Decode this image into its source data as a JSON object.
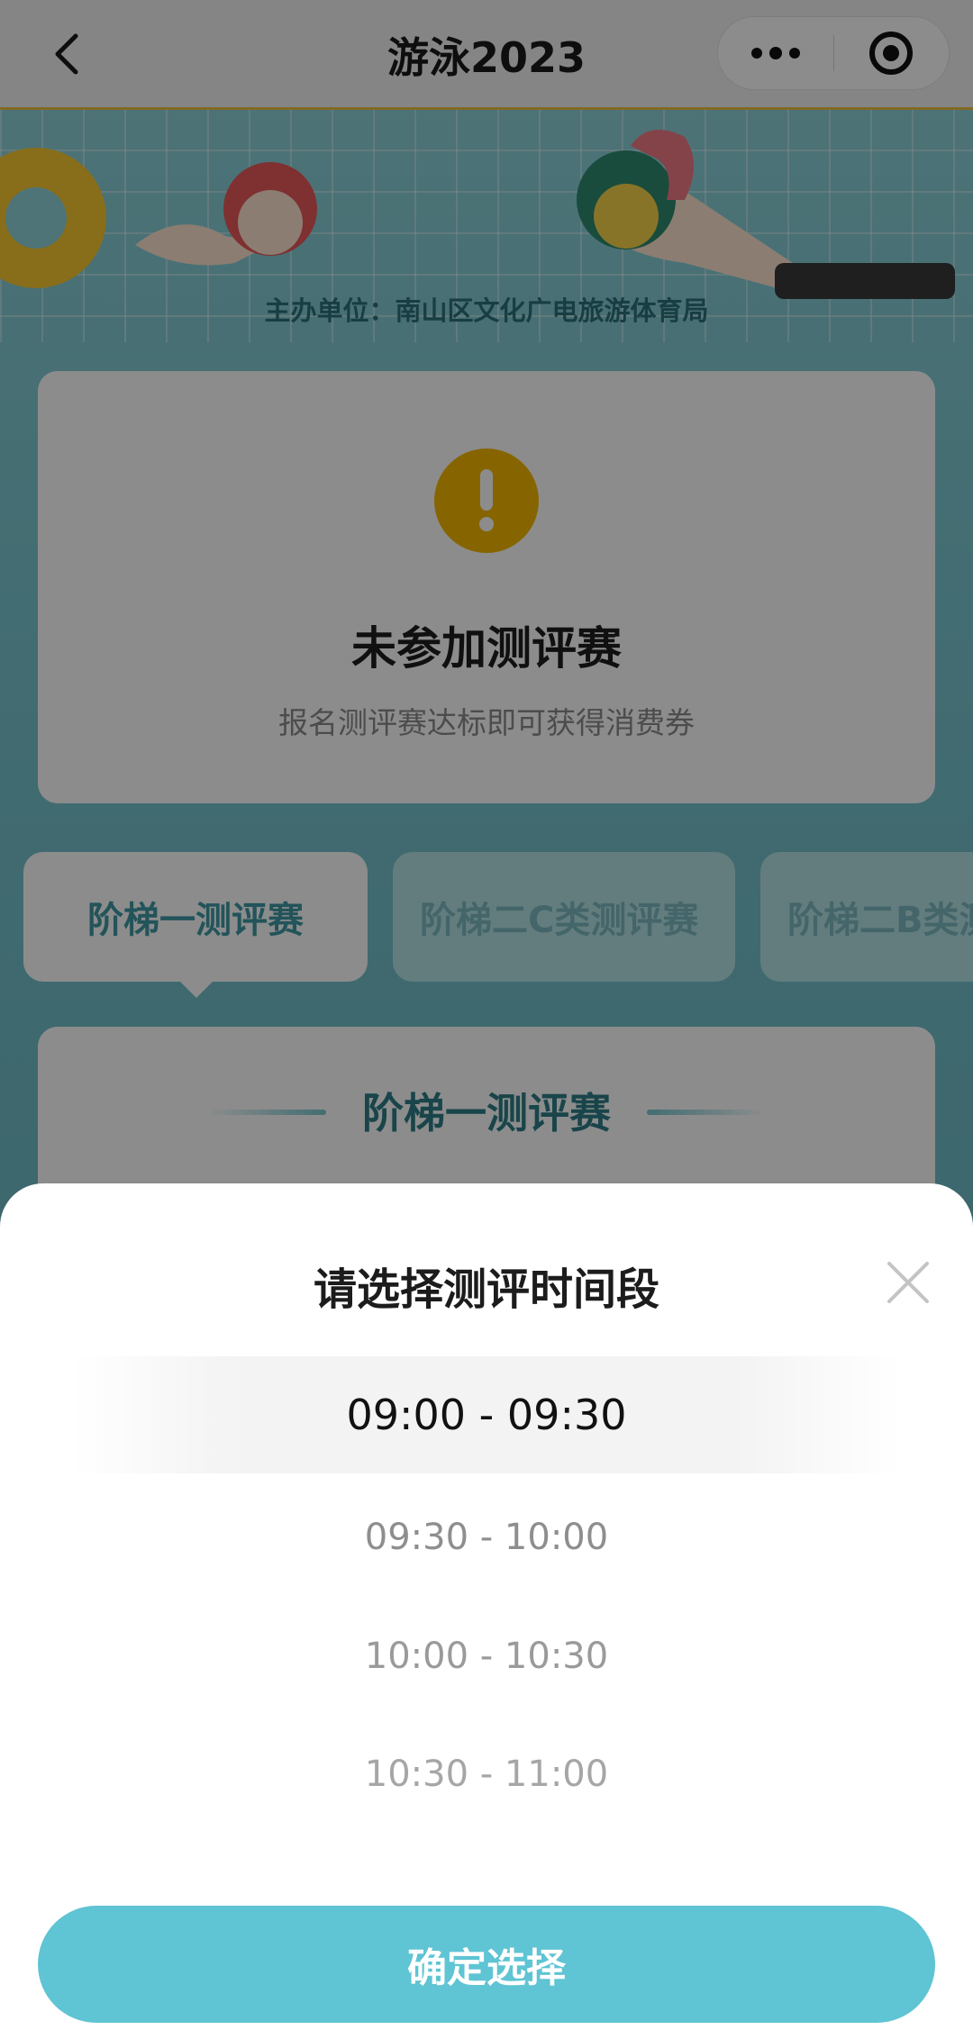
{
  "nav": {
    "title": "游泳2023",
    "back_icon": "chevron-left-icon",
    "more_icon": "more-dots-icon",
    "close_icon": "target-circle-icon"
  },
  "banner": {
    "organizer": "主办单位：南山区文化广电旅游体育局"
  },
  "status_card": {
    "icon": "warning-icon",
    "icon_color": "#f5b800",
    "title": "未参加测评赛",
    "subtitle": "报名测评赛达标即可获得消费券"
  },
  "tabs": [
    {
      "label": "阶梯一测评赛",
      "active": true
    },
    {
      "label": "阶梯二C类测评赛",
      "active": false
    },
    {
      "label": "阶梯二B类测评赛",
      "active": false
    }
  ],
  "detail_card": {
    "title": "阶梯一测评赛"
  },
  "sheet": {
    "title": "请选择测评时间段",
    "close_icon": "close-icon",
    "options": [
      {
        "label": "09:00 - 09:30",
        "selected": true
      },
      {
        "label": "09:30 - 10:00",
        "selected": false
      },
      {
        "label": "10:00 - 10:30",
        "selected": false
      },
      {
        "label": "10:30 - 11:00",
        "selected": false
      }
    ],
    "confirm_label": "确定选择",
    "accent_color": "#5fc4d3"
  }
}
